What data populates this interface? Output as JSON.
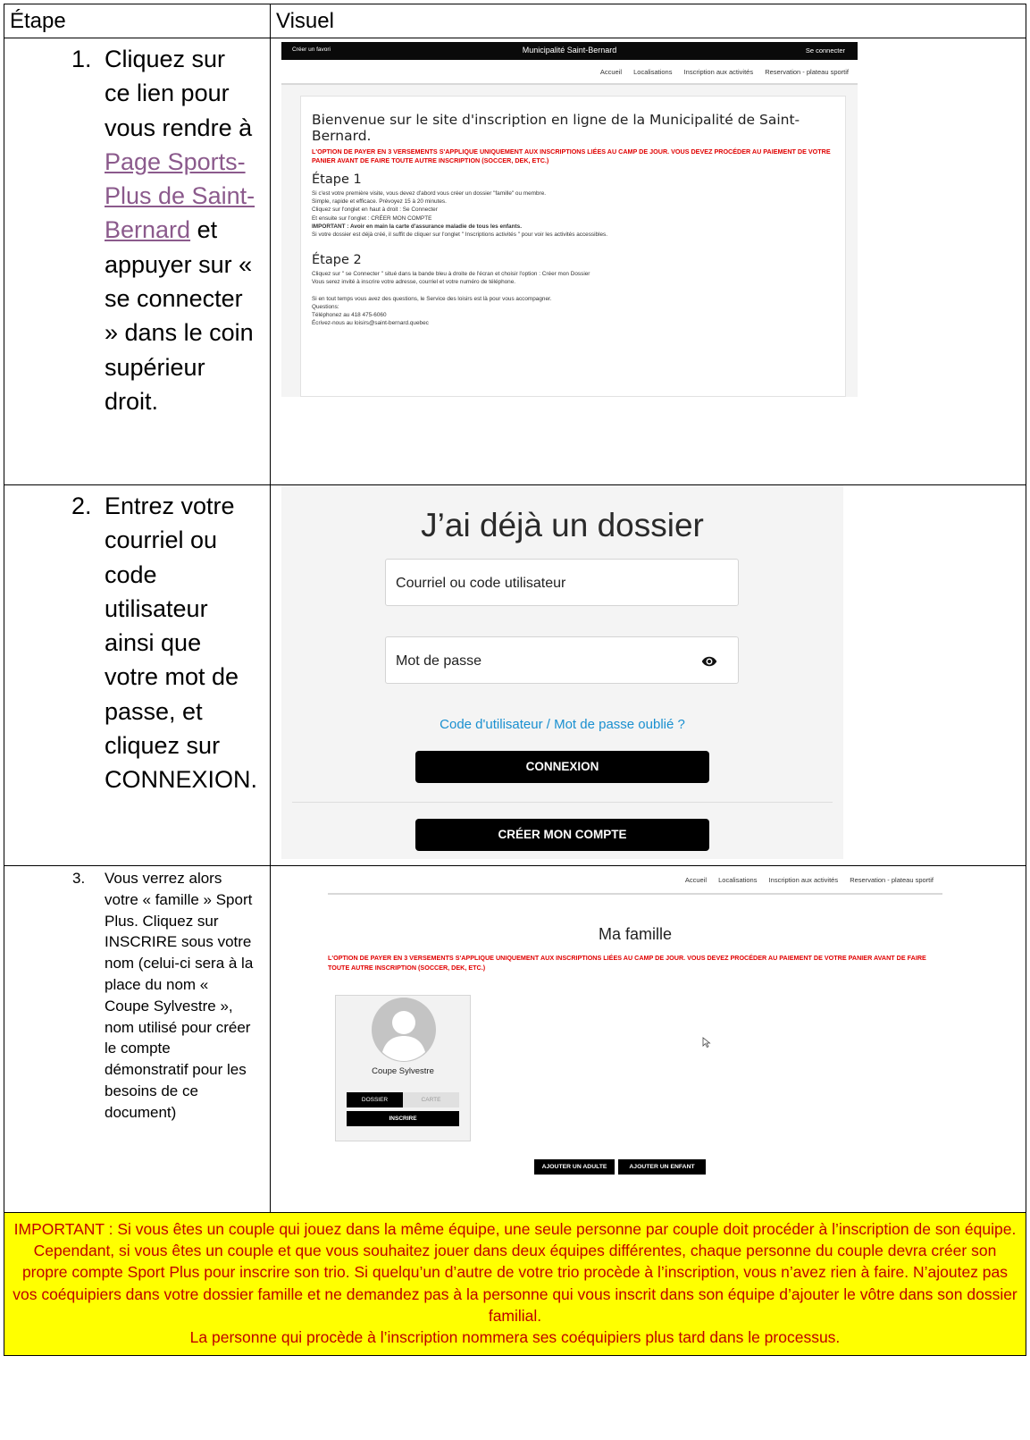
{
  "table": {
    "header_step": "Étape",
    "header_visual": "Visuel"
  },
  "step1": {
    "number": "1.",
    "text_before": "Cliquez sur ce lien pour vous rendre à ",
    "link": "Page Sports-Plus de Saint-Bernard",
    "text_after": " et appuyer sur « se connecter » dans le coin supérieur droit."
  },
  "site": {
    "top_left": "Créer un favori",
    "top_title": "Municipalité Saint-Bernard",
    "top_login": "Se connecter",
    "nav": [
      "Accueil",
      "Localisations",
      "Inscription aux activités",
      "Reservation - plateau sportif"
    ],
    "welcome": "Bienvenue sur le site d'inscription en ligne de la Municipalité de Saint-Bernard.",
    "red_notice": "L'OPTION  DE PAYER EN 3 VERSEMENTS S'APPLIQUE UNIQUEMENT AUX INSCRIPTIONS LIÉES AU CAMP DE JOUR. VOUS DEVEZ PROCÉDER AU PAIEMENT DE VOTRE PANIER AVANT DE FAIRE TOUTE AUTRE INSCRIPTION (SOCCER, DEK, ETC.)",
    "etape1_title": "Étape 1",
    "etape1_lines": [
      "Si c'est votre première visite, vous devez d'abord vous créer un dossier \"famille\" ou membre.",
      "Simple, rapide et efficace. Prévoyez 15 à 20 minutes.",
      "Cliquez sur l'onglet en haut à droit : Se Connecter",
      "Et ensuite sur l'onglet : CRÉER MON COMPTE"
    ],
    "etape1_important": "IMPORTANT : Avoir en main la carte d'assurance maladie de tous les enfants.",
    "etape1_last": "Si votre dossier est déjà créé, il suffit de cliquer sur l'onglet \" Inscriptions activités \" pour voir les activités accessibles.",
    "etape2_title": "Étape 2",
    "etape2_lines": [
      "Cliquez sur \" se Connecter \" situé dans la bande bleu à droite de l'écran et choisir l'option : Créer mon Dossier",
      "Vous serez invité à inscrire votre adresse, courriel et votre numéro de téléphone."
    ],
    "etape2_more": [
      "Si en tout temps vous avez des questions, le Service des loisirs est là pour vous accompagner.",
      "Questions:",
      "Téléphonez au 418 475-6060",
      "Écrivez-nous au loisirs@saint-bernard.quebec"
    ]
  },
  "step2": {
    "number": "2.",
    "text": "Entrez votre courriel ou code utilisateur ainsi que votre mot de passe, et cliquez sur CONNEXION."
  },
  "login": {
    "title": "J’ai déjà un dossier",
    "email_placeholder": "Courriel ou code utilisateur",
    "password_placeholder": "Mot de passe",
    "forgot": "Code d'utilisateur / Mot de passe oublié ?",
    "connect": "CONNEXION",
    "create": "CRÉER MON COMPTE"
  },
  "step3": {
    "number": "3.",
    "text": "Vous verrez alors votre « famille » Sport Plus. Cliquez sur INSCRIRE sous votre nom (celui-ci sera à la place du nom « Coupe Sylvestre », nom utilisé pour créer le compte démonstratif pour les besoins de ce document)"
  },
  "family": {
    "nav": [
      "Accueil",
      "Localisations",
      "Inscription aux activités",
      "Reservation - plateau sportif"
    ],
    "title": "Ma famille",
    "red_notice": "L'OPTION  DE PAYER EN 3 VERSEMENTS S'APPLIQUE UNIQUEMENT AUX INSCRIPTIONS LIÉES AU CAMP DE JOUR. VOUS DEVEZ PROCÉDER AU PAIEMENT DE VOTRE PANIER AVANT DE FAIRE TOUTE AUTRE INSCRIPTION (SOCCER, DEK, ETC.)",
    "member_name": "Coupe Sylvestre",
    "tab_dossier": "DOSSIER",
    "tab_carte": "CARTE",
    "inscrire": "INSCRIRE",
    "add_adult": "AJOUTER UN ADULTE",
    "add_child": "AJOUTER UN ENFANT"
  },
  "important": {
    "text": "IMPORTANT : Si vous êtes un couple qui jouez dans la même équipe, une seule personne par couple doit procéder à l’inscription de son équipe. Cependant, si vous êtes un couple et que vous souhaitez jouer dans deux équipes différentes, chaque personne du couple devra créer son propre compte Sport Plus pour inscrire son trio. Si quelqu’un d’autre de votre trio procède à l’inscription, vous n’avez rien à faire. N’ajoutez pas vos coéquipiers dans votre dossier famille et ne demandez pas à la personne qui vous inscrit dans son équipe d’ajouter le vôtre dans son dossier familial.",
    "text2": "La personne qui procède à l’inscription nommera ses coéquipiers plus tard dans le processus."
  },
  "colors": {
    "important_bg": "#ffff00",
    "important_text": "#c00000",
    "link": "#8b5a8c",
    "accent_blue": "#1a90d0",
    "notice_red": "#e00000"
  }
}
